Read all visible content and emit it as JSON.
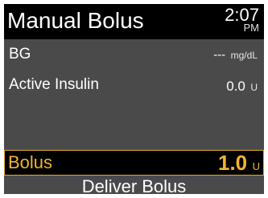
{
  "header": {
    "title": "Manual Bolus",
    "time": "2:07",
    "ampm": "PM"
  },
  "bg": {
    "label": "BG",
    "value": "---",
    "unit": "mg/dL"
  },
  "active_insulin": {
    "label": "Active Insulin",
    "value": "0.0",
    "unit": "U"
  },
  "bolus": {
    "label": "Bolus",
    "value": "1.0",
    "unit": "U"
  },
  "deliver": {
    "label": "Deliver Bolus"
  },
  "colors": {
    "accent": "#f2b52c",
    "panel": "#4a4a4a",
    "background": "#000000"
  }
}
